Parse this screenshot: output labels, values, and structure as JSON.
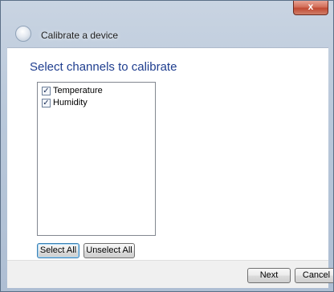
{
  "window": {
    "close_glyph": "x"
  },
  "header": {
    "title": "Calibrate a device",
    "back_icon": "back-arrow-icon"
  },
  "main": {
    "heading": "Select channels to calibrate",
    "channels": [
      {
        "label": "Temperature",
        "checked": true
      },
      {
        "label": "Humidity",
        "checked": true
      }
    ],
    "select_all_label": "Select All",
    "unselect_all_label": "Unselect All"
  },
  "footer": {
    "next_label": "Next",
    "cancel_label": "Cancel"
  },
  "colors": {
    "heading": "#1f3e8f",
    "close_button": "#c14a33",
    "chrome": "#b9c8da"
  }
}
